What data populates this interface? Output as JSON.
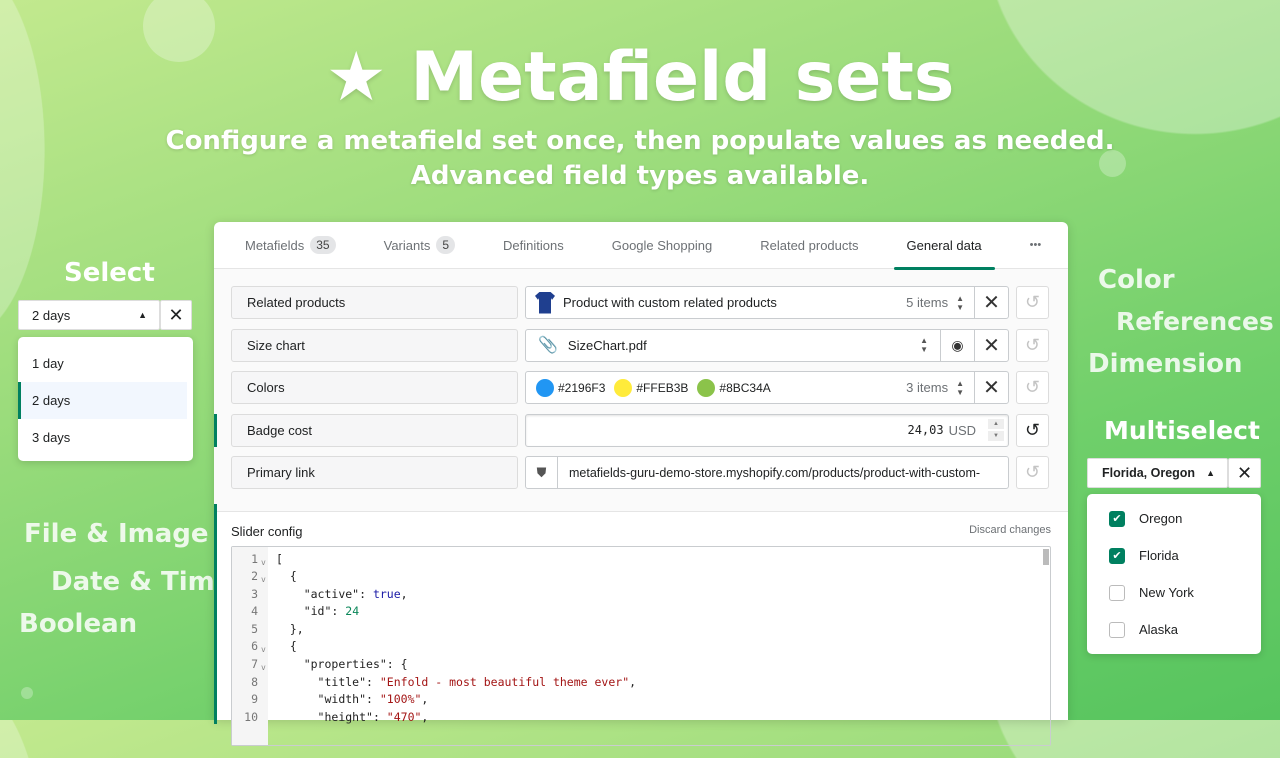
{
  "hero": {
    "star": "★",
    "title": "Metafield sets",
    "subtitle_1": "Configure a metafield set once, then populate values as needed.",
    "subtitle_2": "Advanced field types available."
  },
  "floating_labels": {
    "select": "Select",
    "color": "Color",
    "references": "References",
    "dimension": "Dimension",
    "multiselect": "Multiselect",
    "file_image": "File & Image",
    "date_time": "Date & Time",
    "boolean": "Boolean"
  },
  "tabs": [
    {
      "label": "Metafields",
      "badge": "35"
    },
    {
      "label": "Variants",
      "badge": "5"
    },
    {
      "label": "Definitions"
    },
    {
      "label": "Google Shopping"
    },
    {
      "label": "Related products"
    },
    {
      "label": "General data",
      "active": true
    }
  ],
  "more": "•••",
  "fields": [
    {
      "label": "Related products",
      "value": "Product with custom related products",
      "count": "5 items"
    },
    {
      "label": "Size chart",
      "value": "SizeChart.pdf"
    },
    {
      "label": "Colors",
      "colors": [
        {
          "hex": "#2196F3"
        },
        {
          "hex": "#FFEB3B"
        },
        {
          "hex": "#8BC34A"
        }
      ],
      "count": "3 items"
    },
    {
      "label": "Badge cost",
      "value": "24,03",
      "unit": "USD"
    },
    {
      "label": "Primary link",
      "value": "metafields-guru-demo-store.myshopify.com/products/product-with-custom-"
    }
  ],
  "slider": {
    "label": "Slider config",
    "discard": "Discard changes",
    "lines": [
      "[",
      "  {",
      "    \"active\": true,",
      "    \"id\": 24",
      "  },",
      "  {",
      "    \"properties\": {",
      "      \"title\": \"Enfold - most beautiful theme ever\",",
      "      \"width\": \"100%\",",
      "      \"height\": \"470\","
    ],
    "folds": [
      1,
      2,
      6,
      7
    ]
  },
  "select": {
    "value": "2 days",
    "options": [
      "1 day",
      "2 days",
      "3 days"
    ],
    "selected": "2 days"
  },
  "multiselect": {
    "value": "Florida, Oregon",
    "options": [
      {
        "label": "Oregon",
        "checked": true
      },
      {
        "label": "Florida",
        "checked": true
      },
      {
        "label": "New York",
        "checked": false
      },
      {
        "label": "Alaska",
        "checked": false
      }
    ]
  },
  "colors": {
    "accent": "#008060"
  }
}
